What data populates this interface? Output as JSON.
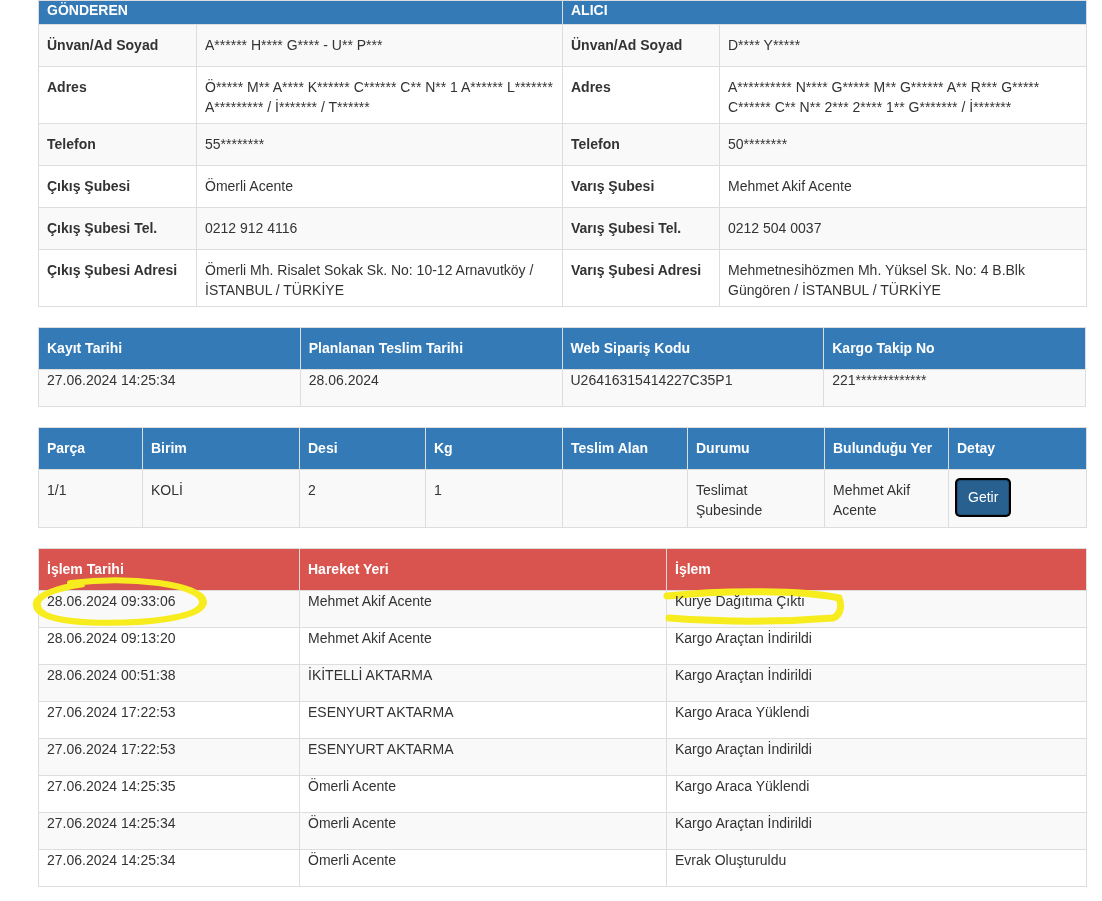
{
  "parties": {
    "sender_title": "GÖNDEREN",
    "receiver_title": "ALICI",
    "rows": [
      {
        "sender_label": "Ünvan/Ad Soyad",
        "sender_value": "A****** H**** G**** - U** P***",
        "receiver_label": "Ünvan/Ad Soyad",
        "receiver_value": "D**** Y*****"
      },
      {
        "sender_label": "Adres",
        "sender_value": "Ö***** M** A**** K****** C****** C** N** 1 A****** L******* A********* / İ******* / T******",
        "receiver_label": "Adres",
        "receiver_value": "A********** N**** G***** M** G****** A** R*** G***** C****** C** N** 2*** 2**** 1** G******* / İ*******"
      },
      {
        "sender_label": "Telefon",
        "sender_value": "55********",
        "receiver_label": "Telefon",
        "receiver_value": "50********"
      },
      {
        "sender_label": "Çıkış Şubesi",
        "sender_value": "Ömerli Acente",
        "receiver_label": "Varış Şubesi",
        "receiver_value": "Mehmet Akif Acente"
      },
      {
        "sender_label": "Çıkış Şubesi Tel.",
        "sender_value": "0212 912 4116",
        "receiver_label": "Varış Şubesi Tel.",
        "receiver_value": "0212 504 0037"
      },
      {
        "sender_label": "Çıkış Şubesi Adresi",
        "sender_value": "Ömerli Mh. Risalet Sokak Sk. No: 10-12 Arnavutköy / İSTANBUL / TÜRKİYE",
        "receiver_label": "Varış Şubesi Adresi",
        "receiver_value": "Mehmetnesihözmen Mh. Yüksel Sk. No: 4 B.Blk Güngören / İSTANBUL / TÜRKİYE"
      }
    ]
  },
  "order": {
    "columns": [
      "Kayıt Tarihi",
      "Planlanan Teslim Tarihi",
      "Web Sipariş Kodu",
      "Kargo Takip No"
    ],
    "values": [
      "27.06.2024 14:25:34",
      "28.06.2024",
      "U26416315414227C35P1",
      "221*************"
    ]
  },
  "parcels": {
    "columns": [
      "Parça",
      "Birim",
      "Desi",
      "Kg",
      "Teslim Alan",
      "Durumu",
      "Bulunduğu Yer",
      "Detay"
    ],
    "rows": [
      {
        "cells": [
          "1/1",
          "KOLİ",
          "2",
          "1",
          "",
          "Teslimat Şubesinde",
          "Mehmet Akif Acente"
        ],
        "button": "Getir"
      }
    ]
  },
  "history": {
    "columns": [
      "İşlem Tarihi",
      "Hareket Yeri",
      "İşlem"
    ],
    "rows": [
      {
        "date": "28.06.2024 09:33:06",
        "place": "Mehmet Akif Acente",
        "action": "Kurye Dağıtıma Çıktı",
        "highlight_date": true,
        "highlight_action": true
      },
      {
        "date": "28.06.2024 09:13:20",
        "place": "Mehmet Akif Acente",
        "action": "Kargo Araçtan İndirildi",
        "highlight_date": false,
        "highlight_action": false
      },
      {
        "date": "28.06.2024 00:51:38",
        "place": "İKİTELLİ AKTARMA",
        "action": "Kargo Araçtan İndirildi",
        "highlight_date": false,
        "highlight_action": false
      },
      {
        "date": "27.06.2024 17:22:53",
        "place": "ESENYURT AKTARMA",
        "action": "Kargo Araca Yüklendi",
        "highlight_date": false,
        "highlight_action": false
      },
      {
        "date": "27.06.2024 17:22:53",
        "place": "ESENYURT AKTARMA",
        "action": "Kargo Araçtan İndirildi",
        "highlight_date": false,
        "highlight_action": false
      },
      {
        "date": "27.06.2024 14:25:35",
        "place": "Ömerli Acente",
        "action": "Kargo Araca Yüklendi",
        "highlight_date": false,
        "highlight_action": false
      },
      {
        "date": "27.06.2024 14:25:34",
        "place": "Ömerli Acente",
        "action": "Kargo Araçtan İndirildi",
        "highlight_date": false,
        "highlight_action": false
      },
      {
        "date": "27.06.2024 14:25:34",
        "place": "Ömerli Acente",
        "action": "Evrak Oluşturuldu",
        "highlight_date": false,
        "highlight_action": false
      }
    ]
  }
}
